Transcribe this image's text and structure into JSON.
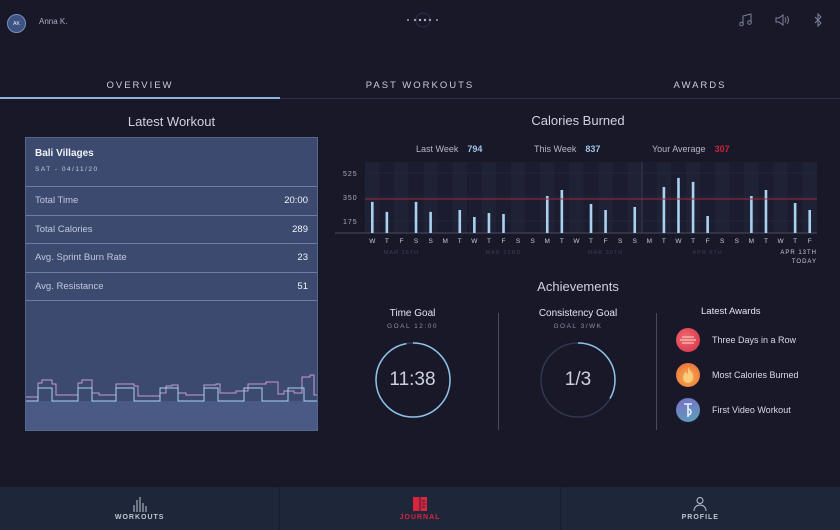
{
  "user": {
    "initials": "AK",
    "name": "Anna K."
  },
  "top_icons": [
    "music-icon",
    "volume-icon",
    "bluetooth-icon"
  ],
  "tabs": [
    {
      "label": "OVERVIEW",
      "active": true
    },
    {
      "label": "PAST WORKOUTS",
      "active": false
    },
    {
      "label": "AWARDS",
      "active": false
    }
  ],
  "latest_workout": {
    "title": "Latest Workout",
    "name": "Bali Villages",
    "date": "SAT - 04/11/20",
    "rows": [
      {
        "label": "Total Time",
        "value": "20:00"
      },
      {
        "label": "Total Calories",
        "value": "289"
      },
      {
        "label": "Avg. Sprint Burn Rate",
        "value": "23"
      },
      {
        "label": "Avg. Resistance",
        "value": "51"
      }
    ]
  },
  "calories": {
    "title": "Calories Burned",
    "last_week_label": "Last Week",
    "last_week_value": "794",
    "this_week_label": "This Week",
    "this_week_value": "837",
    "average_label": "Your Average",
    "average_value": "307",
    "colors": {
      "bar": "#a9d2f0",
      "average": "#c8243c",
      "stat": "#9fc3e6"
    }
  },
  "chart_data": {
    "type": "bar",
    "title": "Calories Burned",
    "yticks": [
      175,
      350,
      525
    ],
    "ylim": [
      87,
      605
    ],
    "average": 335,
    "categories": [
      "W",
      "T",
      "F",
      "S",
      "S",
      "M",
      "T",
      "W",
      "T",
      "F",
      "S",
      "S",
      "M",
      "T",
      "W",
      "T",
      "F",
      "S",
      "S",
      "M",
      "T",
      "W",
      "T",
      "F",
      "S",
      "S",
      "M",
      "T",
      "W",
      "T",
      "F"
    ],
    "values": [
      314,
      241,
      0,
      314,
      241,
      0,
      255,
      204,
      233,
      226,
      0,
      0,
      357,
      401,
      0,
      299,
      255,
      0,
      277,
      0,
      423,
      489,
      460,
      211,
      0,
      0,
      357,
      401,
      0,
      306,
      255
    ],
    "week_labels": [
      {
        "label": "MAR 16TH",
        "index": 1
      },
      {
        "label": "MAR 23RD",
        "index": 8
      },
      {
        "label": "MAR 30TH",
        "index": 15
      },
      {
        "label": "APR 6TH",
        "index": 22
      }
    ],
    "end_label": "APR 13TH",
    "today_label": "TODAY"
  },
  "achievements": {
    "title": "Achievements",
    "time_goal": {
      "title": "Time Goal",
      "sub": "GOAL 12:00",
      "value": "11:38",
      "progress": 0.97
    },
    "consistency_goal": {
      "title": "Consistency Goal",
      "sub": "GOAL 3/WK",
      "value": "1/3",
      "progress": 0.333
    },
    "awards_title": "Latest Awards",
    "awards": [
      {
        "label": "Three Days in a Row",
        "icon": "three-days-award-icon",
        "color": "#e0434f"
      },
      {
        "label": "Most Calories Burned",
        "icon": "flame-award-icon",
        "color": "#f08a3c"
      },
      {
        "label": "First Video Workout",
        "icon": "video-award-icon",
        "color": "#6a7cc4"
      }
    ]
  },
  "bottom_nav": [
    {
      "label": "WORKOUTS",
      "active": false
    },
    {
      "label": "JOURNAL",
      "active": true
    },
    {
      "label": "PROFILE",
      "active": false
    }
  ]
}
